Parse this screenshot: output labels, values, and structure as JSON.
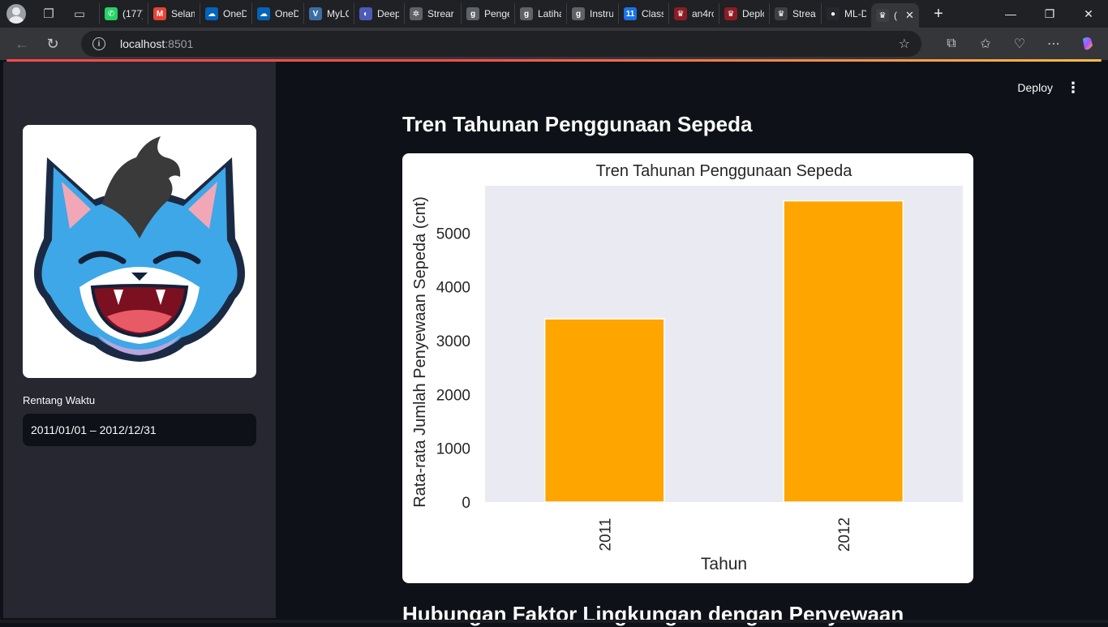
{
  "browser": {
    "tabs": [
      {
        "title": "(177)",
        "icon": "whatsapp-icon",
        "color": "#25D366",
        "glyph": "✆"
      },
      {
        "title": "Selam",
        "icon": "gmail-icon",
        "color": "#EA4335",
        "glyph": "M"
      },
      {
        "title": "OneD",
        "icon": "onedrive-icon",
        "color": "#0364B8",
        "glyph": "☁"
      },
      {
        "title": "OneD",
        "icon": "onedrive-icon",
        "color": "#0364B8",
        "glyph": "☁"
      },
      {
        "title": "MyLO",
        "icon": "mylo-icon",
        "color": "#3b6ea5",
        "glyph": "V"
      },
      {
        "title": "Deep",
        "icon": "deepl-icon",
        "color": "#4b5bb7",
        "glyph": "◐"
      },
      {
        "title": "Strear",
        "icon": "openai-icon",
        "color": "#5f6368",
        "glyph": "✲"
      },
      {
        "title": "Penge",
        "icon": "g-icon",
        "color": "#5f6368",
        "glyph": "g"
      },
      {
        "title": "Latiha",
        "icon": "g-icon",
        "color": "#5f6368",
        "glyph": "g"
      },
      {
        "title": "Instru",
        "icon": "g-icon",
        "color": "#5f6368",
        "glyph": "g"
      },
      {
        "title": "Class",
        "icon": "calendar-icon",
        "color": "#1a73e8",
        "glyph": "11"
      },
      {
        "title": "an4rc",
        "icon": "streamlit-icon",
        "color": "#8c1c24",
        "glyph": "♛"
      },
      {
        "title": "Deplo",
        "icon": "streamlit-icon",
        "color": "#8c1c24",
        "glyph": "♛"
      },
      {
        "title": "Strea",
        "icon": "streamlit-icon",
        "color": "#3c4043",
        "glyph": "♛"
      },
      {
        "title": "ML-D",
        "icon": "github-icon",
        "color": "#24292e",
        "glyph": "●"
      }
    ],
    "active_tab": {
      "title": "(",
      "icon": "streamlit-icon"
    },
    "url_host": "localhost",
    "url_port": ":8501"
  },
  "app": {
    "deploy_label": "Deploy",
    "menu_glyph": "⋮",
    "sidebar": {
      "date_label": "Rentang Waktu",
      "date_value": "2011/01/01 – 2012/12/31"
    },
    "main": {
      "title": "Tren Tahunan Penggunaan Sepeda",
      "next_title": "Hubungan Faktor Lingkungan dengan Penyewaan"
    }
  },
  "chart_data": {
    "type": "bar",
    "title": "Tren Tahunan Penggunaan Sepeda",
    "xlabel": "Tahun",
    "ylabel": "Rata-rata Jumlah Penyewaan Sepeda (cnt)",
    "categories": [
      "2011",
      "2012"
    ],
    "values": [
      3406,
      5600
    ],
    "ylim": [
      0,
      5880
    ],
    "yticks": [
      0,
      1000,
      2000,
      3000,
      4000,
      5000
    ],
    "bar_color": "#FFA500",
    "plot_bg": "#EAEAF2",
    "grid": false
  }
}
